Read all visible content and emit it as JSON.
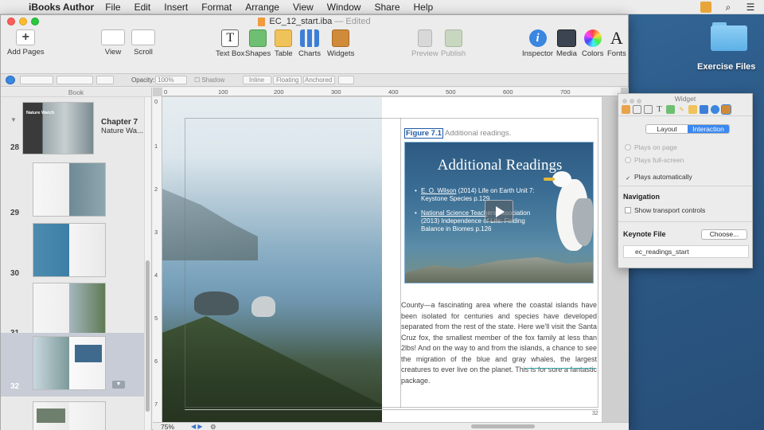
{
  "menubar": {
    "app_name": "iBooks Author",
    "items": [
      "File",
      "Edit",
      "Insert",
      "Format",
      "Arrange",
      "View",
      "Window",
      "Share",
      "Help"
    ]
  },
  "desktop": {
    "folder_label": "Exercise Files"
  },
  "window": {
    "title": "EC_12_start.iba",
    "edited": "— Edited"
  },
  "toolbar": {
    "add_pages": "Add Pages",
    "view": "View",
    "scroll": "Scroll",
    "text_box": "Text Box",
    "shapes": "Shapes",
    "table": "Table",
    "charts": "Charts",
    "widgets": "Widgets",
    "preview": "Preview",
    "publish": "Publish",
    "inspector": "Inspector",
    "media": "Media",
    "colors": "Colors",
    "fonts": "Fonts"
  },
  "formatbar": {
    "opacity_label": "Opacity:",
    "opacity_value": "100%",
    "shadow": "Shadow",
    "inline": "Inline",
    "floating": "Floating",
    "anchored": "Anchored"
  },
  "sidebar": {
    "header": "Book",
    "chapter_title": "Chapter 7",
    "chapter_subtitle": "Nature Wa...",
    "chapter_thumb_text": "Nature Watch",
    "pages": [
      "28",
      "29",
      "30",
      "31",
      "32"
    ]
  },
  "rulers": {
    "top": [
      "0",
      "100",
      "200",
      "300",
      "400",
      "500",
      "600",
      "700"
    ],
    "left": [
      "0",
      "1",
      "2",
      "3",
      "4",
      "5",
      "6",
      "7"
    ]
  },
  "page": {
    "caption_figure": "Figure 7.1",
    "caption_text": "Additional readings.",
    "widget_title": "Additional Readings",
    "readings": [
      {
        "link": "E. O. Wilson",
        "text": " (2014) Life on Earth Unit 7: Keystone Species p.129"
      },
      {
        "link": "National Science Teach",
        "text": "ers Association (2013) Independence of Life: Finding Balance in Biomes p.126"
      }
    ],
    "body_text": "County—a fascinating area where the coastal islands have been isolated for centuries and species have developed separated from the rest of the state. Here we'll visit the Santa Cruz fox, the smallest member of the fox family at less than 2lbs! And on the way to and from the islands, a chance to see the migration of the blue and gray whales, the largest creatures to ever live on the planet. This is for sure a fantastic package.",
    "page_number": "32"
  },
  "zoom": {
    "value": "75%"
  },
  "inspector": {
    "title": "Widget",
    "tabs": [
      "Layout",
      "Interaction"
    ],
    "active_tab": "Interaction",
    "plays_on_page": "Plays on page",
    "plays_full_screen": "Plays full-screen",
    "plays_automatically": "Plays automatically",
    "navigation_head": "Navigation",
    "show_transport": "Show transport controls",
    "keynote_head": "Keynote File",
    "choose": "Choose...",
    "file_name": "ec_readings_start"
  }
}
